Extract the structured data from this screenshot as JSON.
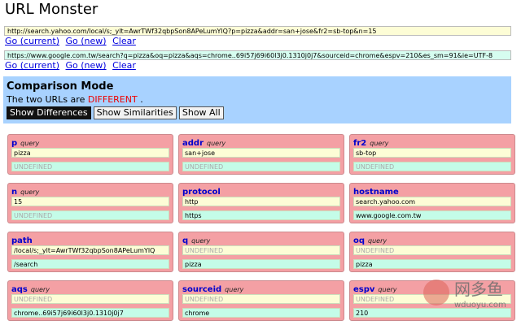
{
  "app": {
    "title": "URL Monster"
  },
  "url1": {
    "value": "http://search.yahoo.com/local/s;_ylt=AwrTWf32qbpSon8APeLumYlQ?p=pizza&addr=san+jose&fr2=sb-top&n=15",
    "go_current": "Go (current)",
    "go_new": "Go (new)",
    "clear": "Clear"
  },
  "url2": {
    "value": "https://www.google.com.tw/search?q=pizza&oq=pizza&aqs=chrome..69i57j69i60l3j0.1310j0j7&sourceid=chrome&espv=210&es_sm=91&ie=UTF-8",
    "go_current": "Go (current)",
    "go_new": "Go (new)",
    "clear": "Clear"
  },
  "comparison": {
    "title": "Comparison Mode",
    "status_prefix": "The two URLs are",
    "status_value": "DIFFERENT",
    "status_suffix": ".",
    "buttons": {
      "differences": "Show Differences",
      "similarities": "Show Similarities",
      "all": "Show All"
    }
  },
  "params": [
    {
      "name": "p",
      "type": "query",
      "v1": "pizza",
      "v2": "UNDEFINED"
    },
    {
      "name": "addr",
      "type": "query",
      "v1": "san+jose",
      "v2": "UNDEFINED"
    },
    {
      "name": "fr2",
      "type": "query",
      "v1": "sb-top",
      "v2": "UNDEFINED"
    },
    {
      "name": "n",
      "type": "query",
      "v1": "15",
      "v2": "UNDEFINED"
    },
    {
      "name": "protocol",
      "type": "",
      "v1": "http",
      "v2": "https"
    },
    {
      "name": "hostname",
      "type": "",
      "v1": "search.yahoo.com",
      "v2": "www.google.com.tw"
    },
    {
      "name": "path",
      "type": "",
      "v1": "/local/s;_ylt=AwrTWf32qbpSon8APeLumYlQ",
      "v2": "/search"
    },
    {
      "name": "q",
      "type": "query",
      "v1": "UNDEFINED",
      "v2": "pizza"
    },
    {
      "name": "oq",
      "type": "query",
      "v1": "UNDEFINED",
      "v2": "pizza"
    },
    {
      "name": "aqs",
      "type": "query",
      "v1": "UNDEFINED",
      "v2": "chrome..69i57j69i60l3j0.1310j0j7"
    },
    {
      "name": "sourceid",
      "type": "query",
      "v1": "UNDEFINED",
      "v2": "chrome"
    },
    {
      "name": "espv",
      "type": "query",
      "v1": "UNDEFINED",
      "v2": "210"
    }
  ],
  "watermark": {
    "cn": "网多鱼",
    "en": "wduoyu.com"
  }
}
